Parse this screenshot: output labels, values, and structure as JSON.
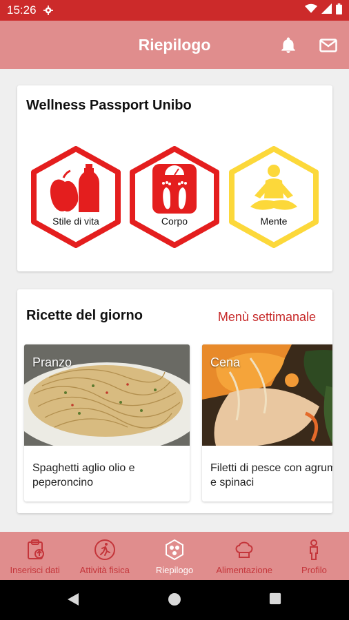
{
  "status_bar": {
    "time": "15:26"
  },
  "header": {
    "title": "Riepilogo"
  },
  "passport": {
    "title": "Wellness Passport Unibo",
    "badges": [
      {
        "label": "Stile di vita",
        "color": "#e41e1e"
      },
      {
        "label": "Corpo",
        "color": "#e41e1e"
      },
      {
        "label": "Mente",
        "color": "#fcd83a"
      }
    ]
  },
  "recipes": {
    "title": "Ricette del giorno",
    "weekly_link": "Menù settimanale",
    "items": [
      {
        "meal": "Pranzo",
        "name": "Spaghetti aglio olio e\npeperoncino"
      },
      {
        "meal": "Cena",
        "name": "Filetti di pesce con agrumi\ne spinaci"
      }
    ]
  },
  "bottom_nav": {
    "items": [
      {
        "label": "Inserisci dati"
      },
      {
        "label": "Attività fisica"
      },
      {
        "label": "Riepilogo"
      },
      {
        "label": "Alimentazione"
      },
      {
        "label": "Profilo"
      }
    ]
  },
  "colors": {
    "primary": "#cc2a2a",
    "bar": "#e08d8d",
    "accent_red": "#e41e1e",
    "accent_yellow": "#fcd83a"
  }
}
